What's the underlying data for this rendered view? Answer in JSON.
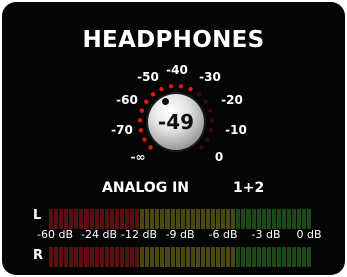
{
  "panel": {
    "title": "HEADPHONES",
    "source_label": "ANALOG IN",
    "channel_label": "1+2"
  },
  "volume_knob": {
    "value": "-49",
    "scale_labels": [
      "-∞",
      "-70",
      "-60",
      "-50",
      "-40",
      "-30",
      "-20",
      "-10",
      "0"
    ],
    "led_color": "#e01818",
    "led_count": 18,
    "leds_lit": 11
  },
  "meter": {
    "left_label": "L",
    "right_label": "R",
    "scale_labels": [
      "-60 dB",
      "-24 dB",
      "-12 dB",
      "-9 dB",
      "-6 dB",
      "-3 dB",
      "0 dB"
    ],
    "left_level": 0,
    "right_level": 0,
    "colors": {
      "low": "#5a1010",
      "mid": "#4a4a10",
      "high": "#1a4a18"
    }
  }
}
